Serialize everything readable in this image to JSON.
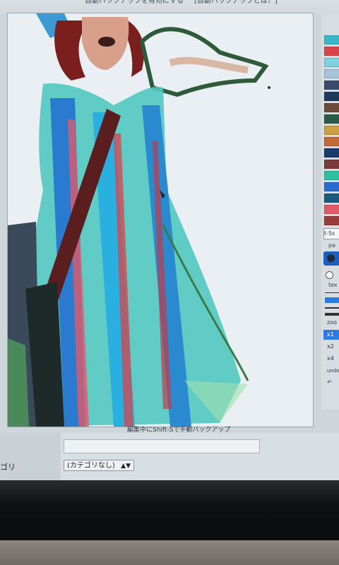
{
  "header": {
    "left_text": "自動バックアップを有効にする",
    "right_text": "[自動バックアップとは？]"
  },
  "canvas": {
    "caption": "編集中にShift-Sで手動バックアップ"
  },
  "palette": {
    "swatches": [
      "#3bb8c8",
      "#d9434a",
      "#7fd0e0",
      "#a8c4d8",
      "#3a4a6a",
      "#1e3a5a",
      "#6b4a3a",
      "#2a5a4a",
      "#c8a040",
      "#c06a3a",
      "#1a3a6a",
      "#7a3a3a",
      "#2ec0a0",
      "#2a6ad0",
      "#1a5a7a",
      "#e05a6a",
      "#9a3a3a"
    ],
    "accent": "#2b7be0",
    "input_value": "t-5ε",
    "pen_label": "pe",
    "brush_icon": "circle-brush-icon",
    "texture_label": "tex",
    "zoom_options": [
      "zoo",
      "x1",
      "x2",
      "x4"
    ],
    "undo_label": "undo"
  },
  "form": {
    "category_label": "ゴリ",
    "category_value": "(カテゴリなし)",
    "title_value": ""
  }
}
